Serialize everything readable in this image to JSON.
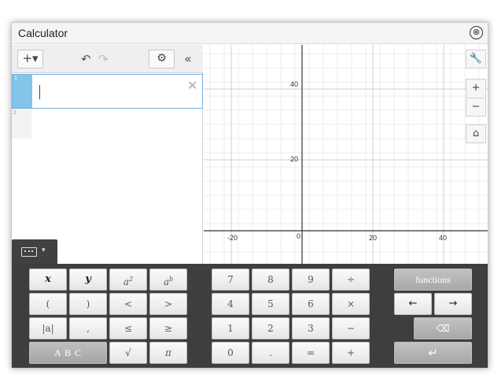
{
  "window": {
    "title": "Calculator",
    "close_icon": "⊗"
  },
  "toolbar": {
    "add_label": "+▾",
    "undo_icon": "↶",
    "redo_icon": "↷",
    "settings_icon": "⚙",
    "collapse_icon": "«"
  },
  "expressions": [
    {
      "number": "1",
      "value": "",
      "delete_icon": "✕"
    },
    {
      "number": "2"
    }
  ],
  "graph": {
    "x_ticks": [
      "-20",
      "0",
      "20",
      "40"
    ],
    "y_ticks": [
      "40",
      "20"
    ],
    "tools": {
      "wrench": "🔧",
      "zoom_in": "+",
      "zoom_out": "−",
      "home": "⌂"
    }
  },
  "keypad": {
    "toggle_caret": "▾",
    "variables": {
      "x": "x",
      "y": "y",
      "a_squared_base": "a",
      "a_squared_exp": "2",
      "a_power_base": "a",
      "a_power_exp": "b"
    },
    "parens": {
      "open": "(",
      "close": ")",
      "lt": "<",
      "gt": ">"
    },
    "misc": {
      "abs": "|a|",
      "comma": ",",
      "le": "≤",
      "ge": "≥"
    },
    "abc": "A B C",
    "sqrt": "√",
    "pi": "π",
    "digits": [
      "7",
      "8",
      "9",
      "4",
      "5",
      "6",
      "1",
      "2",
      "3",
      "0"
    ],
    "ops": {
      "divide": "÷",
      "times": "×",
      "minus": "−",
      "plus": "+",
      "decimal": ".",
      "equals": "="
    },
    "functions": "functions",
    "left_arrow": "←",
    "right_arrow": "→",
    "backspace": "⌫",
    "enter": "↵"
  }
}
